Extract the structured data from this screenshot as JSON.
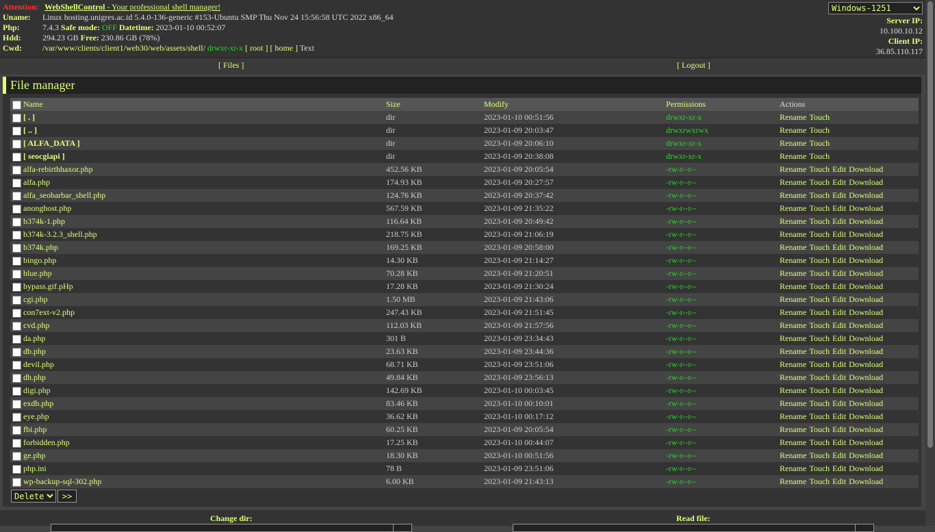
{
  "header": {
    "attention_label": "Attention:",
    "product": "WebShellControl",
    "tagline": " - Your professional shell manager!",
    "uname_label": "Uname:",
    "uname": "Linux hosting.unigres.ac.id 5.4.0-136-generic #153-Ubuntu SMP Thu Nov 24 15:56:58 UTC 2022 x86_64",
    "php_label": "Php:",
    "php_version": "7.4.3",
    "safe_mode_label": "Safe mode:",
    "safe_mode_value": "OFF",
    "datetime_label": "Datetime:",
    "datetime": "2023-01-10 00:52:07",
    "hdd_label": "Hdd:",
    "hdd_total": "294.23 GB",
    "free_label": "Free:",
    "hdd_free": "230.86 GB (78%)",
    "cwd_label": "Cwd:",
    "cwd_path": "/var/www/clients/client1/web30/web/assets/shell/",
    "cwd_perm": "drwxr-xr-x",
    "root_link": "[ root ]",
    "home_link": "[ home ]",
    "text_label": "Text",
    "encoding": "Windows-1251",
    "server_ip_label": "Server IP:",
    "server_ip": "10.100.10.12",
    "client_ip_label": "Client IP:",
    "client_ip": "36.85.110.117"
  },
  "menu": {
    "files": "[ Files ]",
    "logout": "[ Logout ]"
  },
  "file_manager": {
    "title": "File manager",
    "columns": {
      "name": "Name",
      "size": "Size",
      "modify": "Modify",
      "permissions": "Permissions",
      "actions": "Actions"
    },
    "rows": [
      {
        "name": "[ . ]",
        "size": "dir",
        "modify": "2023-01-10 00:51:56",
        "perm": "drwxr-xr-x",
        "dir": true
      },
      {
        "name": "[ .. ]",
        "size": "dir",
        "modify": "2023-01-09 20:03:47",
        "perm": "drwxrwxrwx",
        "dir": true
      },
      {
        "name": "[ ALFA_DATA ]",
        "size": "dir",
        "modify": "2023-01-09 20:06:10",
        "perm": "drwxr-xr-x",
        "dir": true
      },
      {
        "name": "[ seocgiapi ]",
        "size": "dir",
        "modify": "2023-01-09 20:38:08",
        "perm": "drwxr-xr-x",
        "dir": true
      },
      {
        "name": "alfa-rebirthhaxor.php",
        "size": "452.56 KB",
        "modify": "2023-01-09 20:05:54",
        "perm": "-rw-r--r--",
        "dir": false
      },
      {
        "name": "alfa.php",
        "size": "174.93 KB",
        "modify": "2023-01-09 20:27:57",
        "perm": "-rw-r--r--",
        "dir": false
      },
      {
        "name": "alfa_seobarbar_shell.php",
        "size": "124.76 KB",
        "modify": "2023-01-09 20:37:42",
        "perm": "-rw-r--r--",
        "dir": false
      },
      {
        "name": "anonghost.php",
        "size": "567.59 KB",
        "modify": "2023-01-09 21:35:22",
        "perm": "-rw-r--r--",
        "dir": false
      },
      {
        "name": "b374k-1.php",
        "size": "116.64 KB",
        "modify": "2023-01-09 20:49:42",
        "perm": "-rw-r--r--",
        "dir": false
      },
      {
        "name": "b374k-3.2.3_shell.php",
        "size": "218.75 KB",
        "modify": "2023-01-09 21:06:19",
        "perm": "-rw-r--r--",
        "dir": false
      },
      {
        "name": "b374k.php",
        "size": "169.25 KB",
        "modify": "2023-01-09 20:58:00",
        "perm": "-rw-r--r--",
        "dir": false
      },
      {
        "name": "bingo.php",
        "size": "14.30 KB",
        "modify": "2023-01-09 21:14:27",
        "perm": "-rw-r--r--",
        "dir": false
      },
      {
        "name": "blue.php",
        "size": "70.28 KB",
        "modify": "2023-01-09 21:20:51",
        "perm": "-rw-r--r--",
        "dir": false
      },
      {
        "name": "bypass.gif.pHp",
        "size": "17.28 KB",
        "modify": "2023-01-09 21:30:24",
        "perm": "-rw-r--r--",
        "dir": false
      },
      {
        "name": "cgi.php",
        "size": "1.50 MB",
        "modify": "2023-01-09 21:43:06",
        "perm": "-rw-r--r--",
        "dir": false
      },
      {
        "name": "con7ext-v2.php",
        "size": "247.43 KB",
        "modify": "2023-01-09 21:51:45",
        "perm": "-rw-r--r--",
        "dir": false
      },
      {
        "name": "cvd.php",
        "size": "112.03 KB",
        "modify": "2023-01-09 21:57:56",
        "perm": "-rw-r--r--",
        "dir": false
      },
      {
        "name": "da.php",
        "size": "301 B",
        "modify": "2023-01-09 23:34:43",
        "perm": "-rw-r--r--",
        "dir": false
      },
      {
        "name": "db.php",
        "size": "23.63 KB",
        "modify": "2023-01-09 23:44:36",
        "perm": "-rw-r--r--",
        "dir": false
      },
      {
        "name": "devil.php",
        "size": "68.71 KB",
        "modify": "2023-01-09 23:51:06",
        "perm": "-rw-r--r--",
        "dir": false
      },
      {
        "name": "dh.php",
        "size": "49.84 KB",
        "modify": "2023-01-09 23:56:13",
        "perm": "-rw-r--r--",
        "dir": false
      },
      {
        "name": "digi.php",
        "size": "142.69 KB",
        "modify": "2023-01-10 00:03:45",
        "perm": "-rw-r--r--",
        "dir": false
      },
      {
        "name": "exdb.php",
        "size": "83.46 KB",
        "modify": "2023-01-10 00:10:01",
        "perm": "-rw-r--r--",
        "dir": false
      },
      {
        "name": "eye.php",
        "size": "36.62 KB",
        "modify": "2023-01-10 00:17:12",
        "perm": "-rw-r--r--",
        "dir": false
      },
      {
        "name": "fbi.php",
        "size": "60.25 KB",
        "modify": "2023-01-09 20:05:54",
        "perm": "-rw-r--r--",
        "dir": false
      },
      {
        "name": "forbidden.php",
        "size": "17.25 KB",
        "modify": "2023-01-10 00:44:07",
        "perm": "-rw-r--r--",
        "dir": false
      },
      {
        "name": "ge.php",
        "size": "18.30 KB",
        "modify": "2023-01-10 00:51:56",
        "perm": "-rw-r--r--",
        "dir": false
      },
      {
        "name": "php.ini",
        "size": "78 B",
        "modify": "2023-01-09 23:51:06",
        "perm": "-rw-r--r--",
        "dir": false
      },
      {
        "name": "wp-backup-sql-302.php",
        "size": "6.00 KB",
        "modify": "2023-01-09 21:43:13",
        "perm": "-rw-r--r--",
        "dir": false
      }
    ],
    "actions_dir": [
      "Rename",
      "Touch"
    ],
    "actions_file": [
      "Rename",
      "Touch",
      "Edit",
      "Download"
    ],
    "bulk_action": "Delete",
    "go_button": ">>"
  },
  "footer": {
    "change_dir": "Change dir:",
    "read_file": "Read file:"
  },
  "colors": {
    "accent": "#dfff7a",
    "attention": "#ff3030",
    "perm": "#22dd22"
  }
}
